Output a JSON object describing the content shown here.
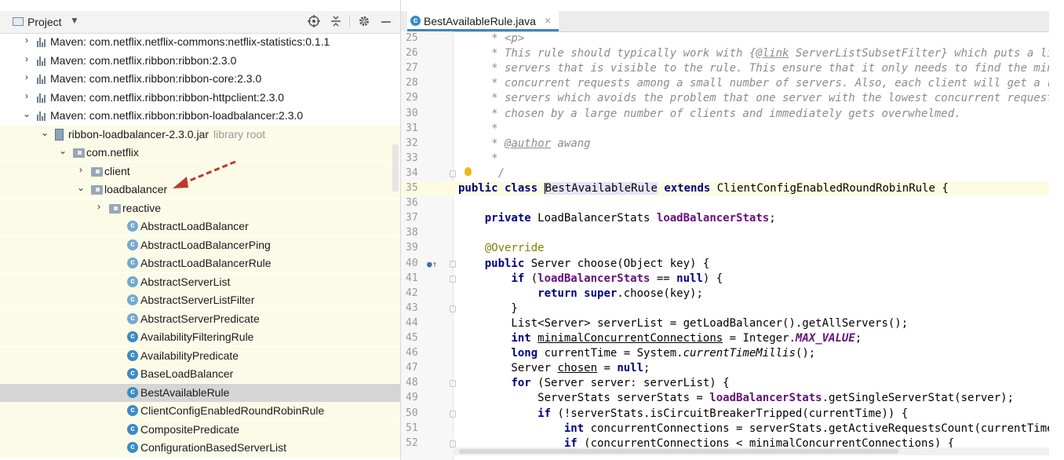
{
  "project_panel": {
    "title": "Project",
    "dropdown_glyph": "▼",
    "toolbar_icons": [
      "target-icon",
      "collapse-all-icon",
      "gear-icon",
      "minimize-icon"
    ],
    "tree": [
      {
        "label": "Maven: com.netflix.netflix-commons:netflix-statistics:0.1.1",
        "icon": "maven-library-icon",
        "arrow": "›",
        "level": 1
      },
      {
        "label": "Maven: com.netflix.ribbon:ribbon:2.3.0",
        "icon": "maven-library-icon",
        "arrow": "›",
        "level": 1
      },
      {
        "label": "Maven: com.netflix.ribbon:ribbon-core:2.3.0",
        "icon": "maven-library-icon",
        "arrow": "›",
        "level": 1
      },
      {
        "label": "Maven: com.netflix.ribbon:ribbon-httpclient:2.3.0",
        "icon": "maven-library-icon",
        "arrow": "›",
        "level": 1
      },
      {
        "label": "Maven: com.netflix.ribbon:ribbon-loadbalancer:2.3.0",
        "icon": "maven-library-icon",
        "arrow": "⌄",
        "level": 1
      },
      {
        "label": "ribbon-loadbalancer-2.3.0.jar",
        "extra": "library root",
        "icon": "jar-icon",
        "arrow": "⌄",
        "level": 2
      },
      {
        "label": "com.netflix",
        "icon": "package-icon",
        "arrow": "⌄",
        "level": 3
      },
      {
        "label": "client",
        "icon": "package-icon",
        "arrow": "›",
        "level": 4
      },
      {
        "label": "loadbalancer",
        "icon": "package-icon",
        "arrow": "⌄",
        "level": 4
      },
      {
        "label": "reactive",
        "icon": "package-icon",
        "arrow": "›",
        "level": 5
      },
      {
        "label": "AbstractLoadBalancer",
        "icon": "abstract-class-icon",
        "level": 6
      },
      {
        "label": "AbstractLoadBalancerPing",
        "icon": "abstract-class-icon",
        "level": 6
      },
      {
        "label": "AbstractLoadBalancerRule",
        "icon": "abstract-class-icon",
        "level": 6
      },
      {
        "label": "AbstractServerList",
        "icon": "abstract-class-icon",
        "level": 6
      },
      {
        "label": "AbstractServerListFilter",
        "icon": "abstract-class-icon",
        "level": 6
      },
      {
        "label": "AbstractServerPredicate",
        "icon": "abstract-class-icon",
        "level": 6
      },
      {
        "label": "AvailabilityFilteringRule",
        "icon": "class-icon",
        "level": 6
      },
      {
        "label": "AvailabilityPredicate",
        "icon": "class-icon",
        "level": 6
      },
      {
        "label": "BaseLoadBalancer",
        "icon": "class-icon",
        "level": 6
      },
      {
        "label": "BestAvailableRule",
        "icon": "class-icon",
        "level": 6,
        "selected": true
      },
      {
        "label": "ClientConfigEnabledRoundRobinRule",
        "icon": "class-icon",
        "level": 6
      },
      {
        "label": "CompositePredicate",
        "icon": "class-icon",
        "level": 6
      },
      {
        "label": "ConfigurationBasedServerList",
        "icon": "class-icon",
        "level": 6
      }
    ]
  },
  "editor": {
    "tab": {
      "label": "BestAvailableRule.java",
      "close": "×",
      "icon": "class-icon"
    },
    "lines": [
      {
        "n": "25",
        "segs": [
          {
            "c": "cm",
            "t": "     * <p>"
          }
        ]
      },
      {
        "n": "26",
        "segs": [
          {
            "c": "cm",
            "t": "     * This rule should typically work with {"
          },
          {
            "c": "cm ul",
            "t": "@link"
          },
          {
            "c": "cm",
            "t": " ServerListSubsetFilter} which puts a limitation on the"
          }
        ]
      },
      {
        "n": "27",
        "segs": [
          {
            "c": "cm",
            "t": "     * servers that is visible to the rule. This ensure that it only needs to find the minimal"
          }
        ]
      },
      {
        "n": "28",
        "segs": [
          {
            "c": "cm",
            "t": "     * concurrent requests among a small number of servers. Also, each client will get a random list of"
          }
        ]
      },
      {
        "n": "29",
        "segs": [
          {
            "c": "cm",
            "t": "     * servers which avoids the problem that one server with the lowest concurrent requests is"
          }
        ]
      },
      {
        "n": "30",
        "segs": [
          {
            "c": "cm",
            "t": "     * chosen by a large number of clients and immediately gets overwhelmed."
          }
        ]
      },
      {
        "n": "31",
        "segs": [
          {
            "c": "cm",
            "t": "     *"
          }
        ]
      },
      {
        "n": "32",
        "segs": [
          {
            "c": "cm",
            "t": "     * "
          },
          {
            "c": "cm ul",
            "t": "@author"
          },
          {
            "c": "cm",
            "t": " awang"
          }
        ]
      },
      {
        "n": "33",
        "segs": [
          {
            "c": "cm",
            "t": "     *"
          }
        ]
      },
      {
        "n": "34",
        "segs": [
          {
            "c": "cm",
            "t": "      /"
          }
        ],
        "bulb": true,
        "fold": true
      },
      {
        "n": "35",
        "cur": true,
        "segs": [
          {
            "c": "kw",
            "t": "public class "
          },
          {
            "c": "caret",
            "t": ""
          },
          {
            "c": "hl",
            "t": "BestAvailableRule"
          },
          {
            "c": "",
            "t": " "
          },
          {
            "c": "kw",
            "t": "extends"
          },
          {
            "c": "",
            "t": " ClientConfigEnabledRoundRobinRule {"
          }
        ]
      },
      {
        "n": "36",
        "segs": []
      },
      {
        "n": "37",
        "segs": [
          {
            "c": "",
            "t": "    "
          },
          {
            "c": "kw",
            "t": "private"
          },
          {
            "c": "",
            "t": " LoadBalancerStats "
          },
          {
            "c": "fld",
            "t": "loadBalancerStats"
          },
          {
            "c": "",
            "t": ";"
          }
        ]
      },
      {
        "n": "38",
        "segs": []
      },
      {
        "n": "39",
        "segs": [
          {
            "c": "ann",
            "t": "    @Override"
          }
        ]
      },
      {
        "n": "40",
        "segs": [
          {
            "c": "",
            "t": "    "
          },
          {
            "c": "kw",
            "t": "public"
          },
          {
            "c": "",
            "t": " Server choose(Object key) {"
          }
        ],
        "override": true,
        "fold": true
      },
      {
        "n": "41",
        "segs": [
          {
            "c": "",
            "t": "        "
          },
          {
            "c": "kw",
            "t": "if"
          },
          {
            "c": "",
            "t": " ("
          },
          {
            "c": "fld",
            "t": "loadBalancerStats"
          },
          {
            "c": "",
            "t": " == "
          },
          {
            "c": "kw",
            "t": "null"
          },
          {
            "c": "",
            "t": ") {"
          }
        ],
        "fold": true
      },
      {
        "n": "42",
        "segs": [
          {
            "c": "",
            "t": "            "
          },
          {
            "c": "kw",
            "t": "return super"
          },
          {
            "c": "",
            "t": ".choose(key);"
          }
        ]
      },
      {
        "n": "43",
        "segs": [
          {
            "c": "",
            "t": "        }"
          }
        ],
        "fold": true
      },
      {
        "n": "44",
        "segs": [
          {
            "c": "",
            "t": "        List<Server> serverList = getLoadBalancer().getAllServers();"
          }
        ]
      },
      {
        "n": "45",
        "segs": [
          {
            "c": "",
            "t": "        "
          },
          {
            "c": "kw",
            "t": "int"
          },
          {
            "c": "",
            "t": " "
          },
          {
            "c": "ul",
            "t": "minimalConcurrentConnections"
          },
          {
            "c": "",
            "t": " = Integer."
          },
          {
            "c": "cst",
            "t": "MAX_VALUE"
          },
          {
            "c": "",
            "t": ";"
          }
        ]
      },
      {
        "n": "46",
        "segs": [
          {
            "c": "",
            "t": "        "
          },
          {
            "c": "kw",
            "t": "long"
          },
          {
            "c": "",
            "t": " currentTime = System."
          },
          {
            "c": "it",
            "t": "currentTimeMillis"
          },
          {
            "c": "",
            "t": "();"
          }
        ]
      },
      {
        "n": "47",
        "segs": [
          {
            "c": "",
            "t": "        Server "
          },
          {
            "c": "ul",
            "t": "chosen"
          },
          {
            "c": "",
            "t": " = "
          },
          {
            "c": "kw",
            "t": "null"
          },
          {
            "c": "",
            "t": ";"
          }
        ]
      },
      {
        "n": "48",
        "segs": [
          {
            "c": "",
            "t": "        "
          },
          {
            "c": "kw",
            "t": "for"
          },
          {
            "c": "",
            "t": " (Server server: serverList) {"
          }
        ],
        "fold": true
      },
      {
        "n": "49",
        "segs": [
          {
            "c": "",
            "t": "            ServerStats serverStats = "
          },
          {
            "c": "fld",
            "t": "loadBalancerStats"
          },
          {
            "c": "",
            "t": ".getSingleServerStat(server);"
          }
        ]
      },
      {
        "n": "50",
        "segs": [
          {
            "c": "",
            "t": "            "
          },
          {
            "c": "kw",
            "t": "if"
          },
          {
            "c": "",
            "t": " (!serverStats.isCircuitBreakerTripped(currentTime)) {"
          }
        ],
        "fold": true
      },
      {
        "n": "51",
        "segs": [
          {
            "c": "",
            "t": "                "
          },
          {
            "c": "kw",
            "t": "int"
          },
          {
            "c": "",
            "t": " concurrentConnections = serverStats.getActiveRequestsCount(currentTime);"
          }
        ]
      },
      {
        "n": "52",
        "segs": [
          {
            "c": "",
            "t": "                "
          },
          {
            "c": "kw",
            "t": "if"
          },
          {
            "c": "",
            "t": " (concurrentConnections < "
          },
          {
            "c": "ul",
            "t": "minimalConcurrentConnections"
          },
          {
            "c": "",
            "t": ") {"
          }
        ],
        "fold": true
      }
    ]
  }
}
